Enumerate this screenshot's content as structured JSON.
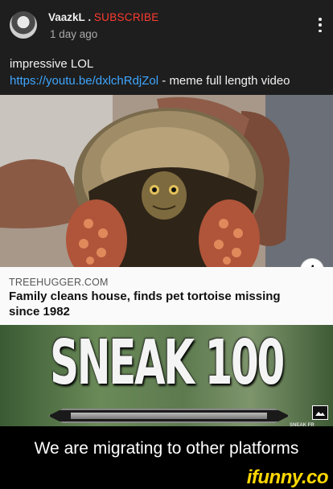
{
  "post": {
    "author": "VaazkL",
    "separator": ".",
    "subscribe": "SUBSCRIBE",
    "age": "1 day ago",
    "comment_line1": "impressive LOL",
    "link": "https://youtu.be/dxlchRdjZol",
    "comment_suffix": " - meme full length video"
  },
  "card": {
    "info_icon_glyph": "i",
    "source": "TREEHUGGER.COM",
    "headline": "Family cleans house, finds pet tortoise missing since 1982"
  },
  "meme": {
    "title": "SNEAK 100",
    "small_text": "SNEAK FR"
  },
  "caption": "We are migrating to other platforms",
  "watermark": "ifunny.co",
  "colors": {
    "subscribe": "#ff3b30",
    "link": "#3ea6ff",
    "watermark": "#ffd800"
  }
}
